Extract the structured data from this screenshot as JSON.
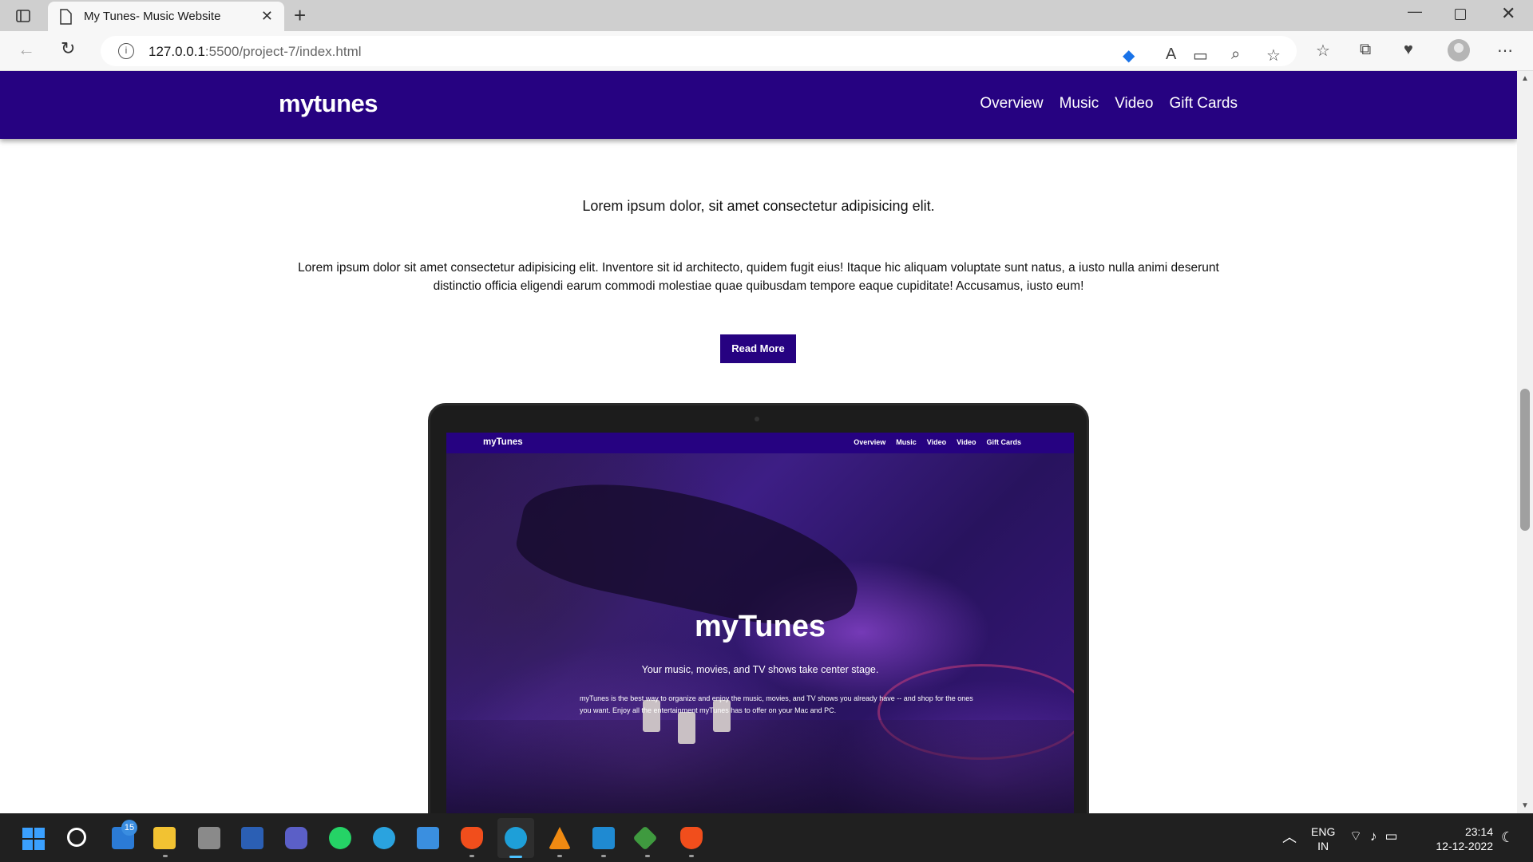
{
  "browser": {
    "tab_title": "My Tunes- Music Website",
    "url_host": "127.0.0.1",
    "url_rest": ":5500/project-7/index.html"
  },
  "site": {
    "logo": "mytunes",
    "nav": [
      "Overview",
      "Music",
      "Video",
      "Gift Cards"
    ],
    "section_title": "Lorem ipsum dolor, sit amet consectetur adipisicing elit.",
    "section_text": "Lorem ipsum dolor sit amet consectetur adipisicing elit. Inventore sit id architecto, quidem fugit eius! Itaque hic aliquam voluptate sunt natus, a iusto nulla animi deserunt distinctio officia eligendi earum commodi molestiae quae quibusdam tempore eaque cupiditate! Accusamus, iusto eum!",
    "read_more": "Read More"
  },
  "preview": {
    "logo": "myTunes",
    "nav": [
      "Overview",
      "Music",
      "Video",
      "Video",
      "Gift Cards"
    ],
    "hero_title": "myTunes",
    "hero_subtitle": "Your music, movies, and TV shows take center stage.",
    "hero_text": "myTunes is the best way to organize and enjoy the music, movies, and TV shows you already have -- and shop for the ones you want. Enjoy all the entertainment myTunes has to offer on your Mac and PC."
  },
  "taskbar": {
    "notification_badge": "15",
    "lang_line1": "ENG",
    "lang_line2": "IN",
    "time": "23:14",
    "date": "12-12-2022"
  },
  "colors": {
    "brand": "#260281"
  }
}
